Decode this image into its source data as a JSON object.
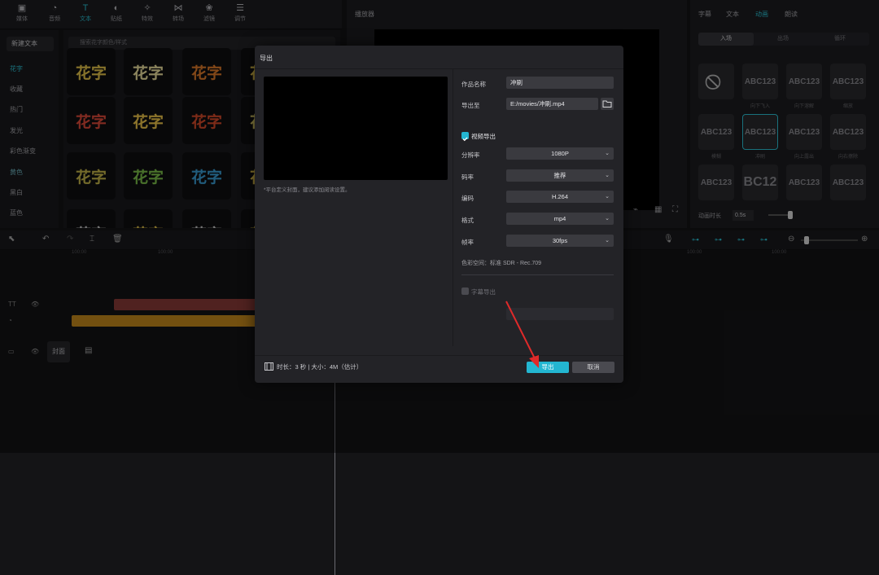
{
  "app": {
    "toolbar": [
      {
        "label": "媒体",
        "icon": "media-icon"
      },
      {
        "label": "音频",
        "icon": "audio-icon"
      },
      {
        "label": "文本",
        "icon": "text-icon",
        "active": true
      },
      {
        "label": "贴纸",
        "icon": "sticker-icon"
      },
      {
        "label": "特效",
        "icon": "effects-icon"
      },
      {
        "label": "转场",
        "icon": "transition-icon"
      },
      {
        "label": "滤镜",
        "icon": "filter-icon"
      },
      {
        "label": "调节",
        "icon": "adjust-icon"
      }
    ],
    "left_nav": {
      "new_text": "新建文本",
      "items": [
        "花字",
        "收藏",
        "热门",
        "发光",
        "彩色渐变",
        "黄色",
        "黑白",
        "蓝色"
      ],
      "active_index": 0
    },
    "search_placeholder": "搜索花字颜色/样式",
    "tile_text": "花字",
    "player_title": "播放器",
    "right_tabs": [
      "字幕",
      "文本",
      "动画",
      "朗读"
    ],
    "right_tab_active": 2,
    "anim_subtabs": [
      "入场",
      "出场",
      "循环"
    ],
    "anim_labels": [
      "",
      "向下飞入",
      "向下溶解",
      "缩放",
      "模糊",
      "冲刷",
      "向上露出",
      "向右擦除",
      "",
      "",
      "",
      ""
    ],
    "anim_texts": [
      "",
      "ABC123",
      "ABC123",
      "ABC123",
      "ABC123",
      "ABC123",
      "ABC123",
      "ABC123",
      "ABC123",
      "BC12",
      "ABC123",
      "ABC123"
    ],
    "anim_duration_label": "动画时长",
    "anim_duration_value": "0.5s",
    "timeline": {
      "ruler_ticks": [
        "100:00",
        "100:00",
        "100:00",
        "100:00"
      ],
      "cover_label": "封面"
    }
  },
  "dialog": {
    "title": "导出",
    "preview_hint": "*平台定义封面，建议添加阅读设置。",
    "fields": {
      "name_label": "作品名称",
      "name_value": "冲刷",
      "export_to_label": "导出至",
      "export_to_value": "E:/movies/冲刷.mp4",
      "video_export_label": "视频导出",
      "resolution_label": "分辨率",
      "resolution_value": "1080P",
      "bitrate_label": "码率",
      "bitrate_value": "推荐",
      "codec_label": "编码",
      "codec_value": "H.264",
      "format_label": "格式",
      "format_value": "mp4",
      "fps_label": "帧率",
      "fps_value": "30fps",
      "color_space": "色彩空间：标准 SDR - Rec.709",
      "subtitle_export_label": "字幕导出"
    },
    "footer": {
      "info": "时长：3 秒 | 大小：4M（估计）",
      "export_button": "导出",
      "cancel_button": "取消"
    }
  },
  "colors": {
    "accent": "#23b6d1",
    "arrow": "#e02a2a",
    "text_track": "#8a3b38",
    "sticker_track": "#c78a1c"
  }
}
